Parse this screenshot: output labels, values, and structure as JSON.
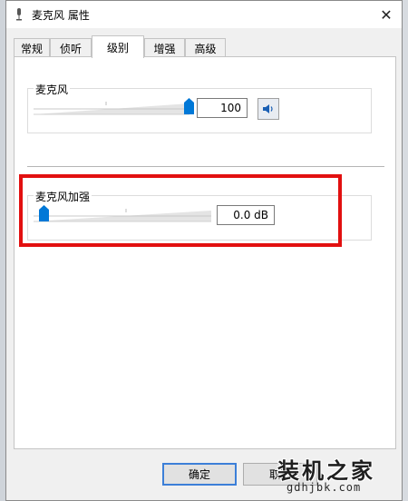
{
  "window": {
    "title": "麦克风 属性"
  },
  "tabs": [
    {
      "label": "常规"
    },
    {
      "label": "侦听"
    },
    {
      "label": "级别"
    },
    {
      "label": "增强"
    },
    {
      "label": "高级"
    }
  ],
  "active_tab": "级别",
  "microphone": {
    "label": "麦克风",
    "value": "100",
    "level": 100
  },
  "boost": {
    "label": "麦克风加强",
    "value": "0.0 dB",
    "level": 0
  },
  "buttons": {
    "ok": "确定",
    "cancel": "取消"
  },
  "watermark": {
    "main": "装机之家",
    "url": "gdhjbk.com"
  },
  "colors": {
    "accent": "#0078d7",
    "highlight": "#e21010"
  }
}
